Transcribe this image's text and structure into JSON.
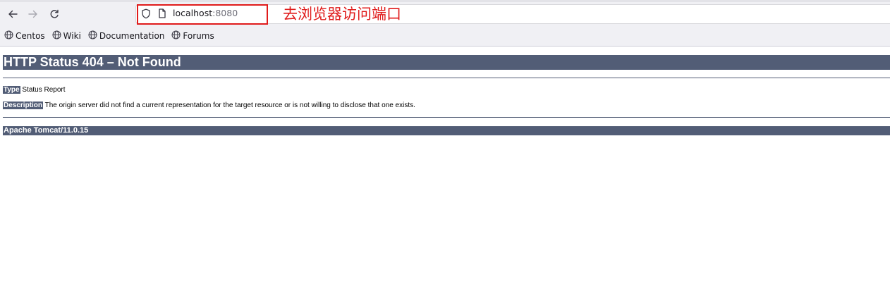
{
  "browser": {
    "url_host": "localhost",
    "url_port": ":8080",
    "annotation_text": "去浏览器访问端口",
    "annotation_color": "#e01b1b",
    "bookmarks": [
      {
        "label": "Centos",
        "icon": "globe-icon"
      },
      {
        "label": "Wiki",
        "icon": "globe-icon"
      },
      {
        "label": "Documentation",
        "icon": "globe-icon"
      },
      {
        "label": "Forums",
        "icon": "globe-icon"
      }
    ]
  },
  "page": {
    "heading": "HTTP Status 404 – Not Found",
    "type_label": "Type",
    "type_value": " Status Report",
    "description_label": "Description",
    "description_value": " The origin server did not find a current representation for the target resource or is not willing to disclose that one exists.",
    "footer": "Apache Tomcat/11.0.15",
    "accent_color": "#525d76"
  }
}
